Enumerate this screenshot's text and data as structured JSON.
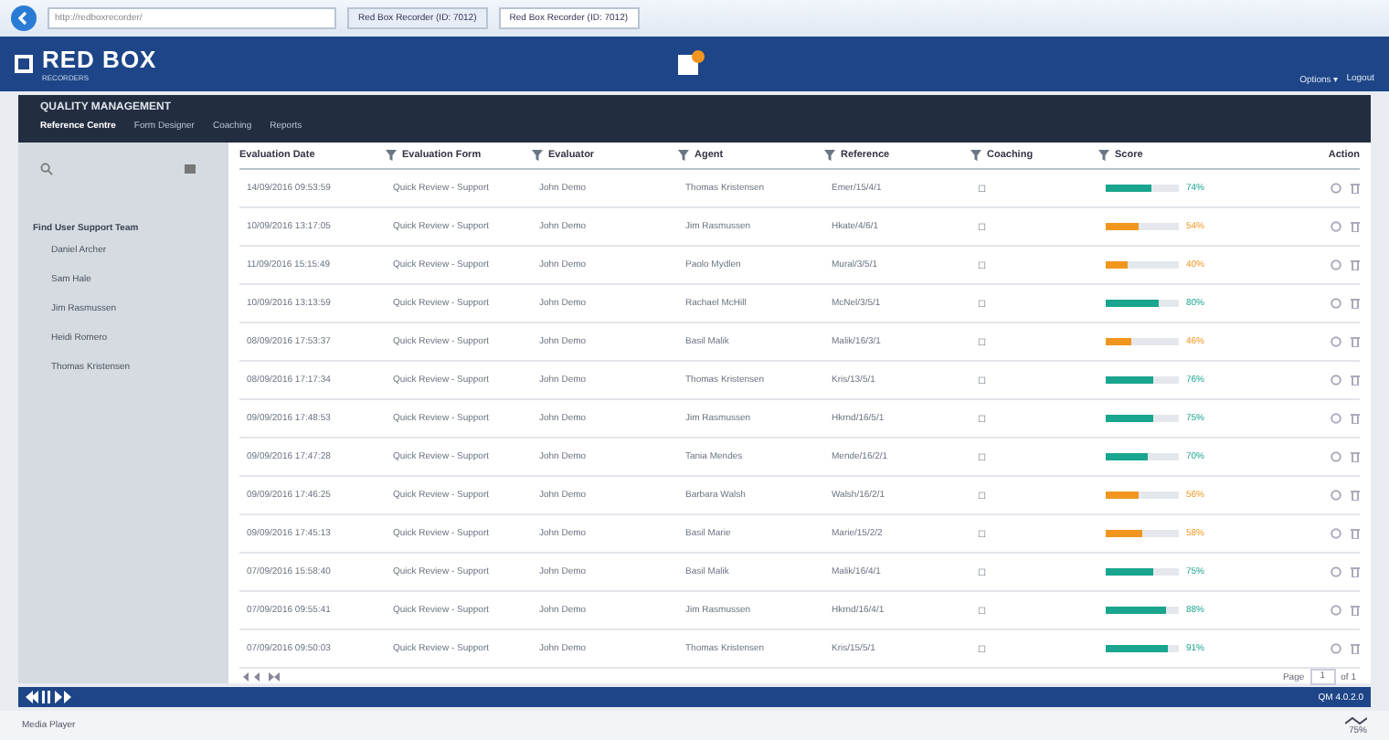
{
  "browser": {
    "address": "http://redboxrecorder/",
    "tabs": [
      {
        "label": "Red Box Recorder (ID: 7012)",
        "selected": false
      },
      {
        "label": "Red Box Recorder (ID: 7012)",
        "selected": true
      }
    ]
  },
  "header": {
    "brand": "RED BOX",
    "tagline": "RECORDERS",
    "links": [
      "Options ▾",
      "Logout"
    ]
  },
  "module": {
    "title": "QUALITY MANAGEMENT",
    "nav": [
      {
        "label": "Reference Centre",
        "selected": true
      },
      {
        "label": "Form Designer",
        "selected": false
      },
      {
        "label": "Coaching",
        "selected": false
      },
      {
        "label": "Reports",
        "selected": false
      }
    ]
  },
  "sidebar": {
    "heading": "Find User Support Team",
    "items": [
      "Daniel Archer",
      "Sam Hale",
      "Jim Rasmussen",
      "Heidi Romero",
      "Thomas Kristensen"
    ]
  },
  "table": {
    "columns": [
      {
        "label": "Evaluation Date",
        "filter": false
      },
      {
        "label": "Evaluation Form",
        "filter": true
      },
      {
        "label": "Evaluator",
        "filter": true
      },
      {
        "label": "Agent",
        "filter": true
      },
      {
        "label": "Reference",
        "filter": true
      },
      {
        "label": "Coaching",
        "filter": true
      },
      {
        "label": "Score",
        "filter": true
      },
      {
        "label": "Action",
        "filter": false
      }
    ],
    "rows": [
      {
        "date": "14/09/2016 09:53:59",
        "form": "Quick Review - Support",
        "evaluator": "John Demo",
        "agent": "Thomas Kristensen",
        "reference": "Emer/15/4/1",
        "coaching": "☐",
        "score": {
          "level": 0.62,
          "color": "#1aa58f",
          "text": "74%"
        }
      },
      {
        "date": "10/09/2016 13:17:05",
        "form": "Quick Review - Support",
        "evaluator": "John Demo",
        "agent": "Jim Rasmussen",
        "reference": "Hkate/4/6/1",
        "coaching": "☐",
        "score": {
          "level": 0.45,
          "color": "#f0961e",
          "text": "54%"
        }
      },
      {
        "date": "11/09/2016 15:15:49",
        "form": "Quick Review - Support",
        "evaluator": "John Demo",
        "agent": "Paolo Mydlen",
        "reference": "Mural/3/5/1",
        "coaching": "☐",
        "score": {
          "level": 0.3,
          "color": "#f0961e",
          "text": "40%"
        }
      },
      {
        "date": "10/09/2016 13:13:59",
        "form": "Quick Review - Support",
        "evaluator": "John Demo",
        "agent": "Rachael McHill",
        "reference": "McNel/3/5/1",
        "coaching": "☐",
        "score": {
          "level": 0.72,
          "color": "#1aa58f",
          "text": "80%"
        }
      },
      {
        "date": "08/09/2016 17:53:37",
        "form": "Quick Review - Support",
        "evaluator": "John Demo",
        "agent": "Basil Malik",
        "reference": "Malik/16/3/1",
        "coaching": "☐",
        "score": {
          "level": 0.35,
          "color": "#f0961e",
          "text": "46%"
        }
      },
      {
        "date": "08/09/2016 17:17:34",
        "form": "Quick Review - Support",
        "evaluator": "John Demo",
        "agent": "Thomas Kristensen",
        "reference": "Kris/13/5/1",
        "coaching": "☐",
        "score": {
          "level": 0.66,
          "color": "#1aa58f",
          "text": "76%"
        }
      },
      {
        "date": "09/09/2016 17:48:53",
        "form": "Quick Review - Support",
        "evaluator": "John Demo",
        "agent": "Jim Rasmussen",
        "reference": "Hkrnd/16/5/1",
        "coaching": "☐",
        "score": {
          "level": 0.66,
          "color": "#1aa58f",
          "text": "75%"
        }
      },
      {
        "date": "09/09/2016 17:47:28",
        "form": "Quick Review - Support",
        "evaluator": "John Demo",
        "agent": "Tania Mendes",
        "reference": "Mende/16/2/1",
        "coaching": "☐",
        "score": {
          "level": 0.58,
          "color": "#1aa58f",
          "text": "70%"
        }
      },
      {
        "date": "09/09/2016 17:46:25",
        "form": "Quick Review - Support",
        "evaluator": "John Demo",
        "agent": "Barbara Walsh",
        "reference": "Walsh/16/2/1",
        "coaching": "☐",
        "score": {
          "level": 0.45,
          "color": "#f0961e",
          "text": "56%"
        }
      },
      {
        "date": "09/09/2016 17:45:13",
        "form": "Quick Review - Support",
        "evaluator": "John Demo",
        "agent": "Basil Marie",
        "reference": "Marie/15/2/2",
        "coaching": "☐",
        "score": {
          "level": 0.5,
          "color": "#f0961e",
          "text": "58%"
        }
      },
      {
        "date": "07/09/2016 15:58:40",
        "form": "Quick Review - Support",
        "evaluator": "John Demo",
        "agent": "Basil Malik",
        "reference": "Malik/16/4/1",
        "coaching": "☐",
        "score": {
          "level": 0.66,
          "color": "#1aa58f",
          "text": "75%"
        }
      },
      {
        "date": "07/09/2016 09:55:41",
        "form": "Quick Review - Support",
        "evaluator": "John Demo",
        "agent": "Jim Rasmussen",
        "reference": "Hkrnd/16/4/1",
        "coaching": "☐",
        "score": {
          "level": 0.82,
          "color": "#1aa58f",
          "text": "88%"
        }
      },
      {
        "date": "07/09/2016 09:50:03",
        "form": "Quick Review - Support",
        "evaluator": "John Demo",
        "agent": "Thomas Kristensen",
        "reference": "Kris/15/5/1",
        "coaching": "☐",
        "score": {
          "level": 0.86,
          "color": "#1aa58f",
          "text": "91%"
        }
      }
    ]
  },
  "pager": {
    "page_label": "Page",
    "page": "1",
    "of": "of 1"
  },
  "player": {
    "version": "QM 4.0.2.0"
  },
  "status_bar": {
    "label": "Media Player",
    "zoom": "75%"
  }
}
